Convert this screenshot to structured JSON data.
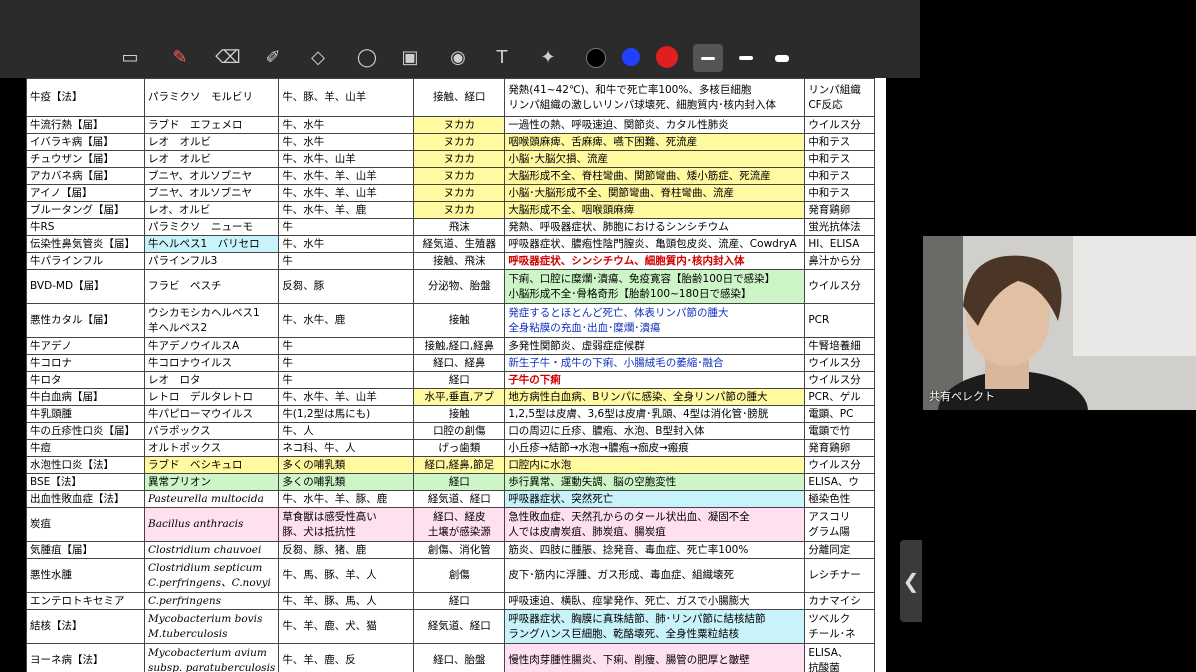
{
  "toolbar": {
    "tools": [
      {
        "name": "layers-icon",
        "glyph": "▭"
      },
      {
        "name": "pen-icon",
        "glyph": "✎"
      },
      {
        "name": "eraser-icon",
        "glyph": "⌫"
      },
      {
        "name": "highlighter-icon",
        "glyph": "✐"
      },
      {
        "name": "shapes-icon",
        "glyph": "◇"
      },
      {
        "name": "lasso-icon",
        "glyph": "◯"
      },
      {
        "name": "image-icon",
        "glyph": "▣"
      },
      {
        "name": "camera-icon",
        "glyph": "◉"
      },
      {
        "name": "text-icon",
        "glyph": "T"
      },
      {
        "name": "laser-pointer-icon",
        "glyph": "✦"
      }
    ],
    "colors": [
      "#000000",
      "#2040ff",
      "#e02020"
    ],
    "line_widths": [
      "thin",
      "medium",
      "thick"
    ]
  },
  "video": {
    "name_label": "共有ペレクト"
  },
  "nav_tab": {
    "glyph": "❮"
  },
  "table": {
    "rows": [
      {
        "h": 38,
        "c1": "牛疫【法】",
        "c2": "パラミクソ　モルビリ",
        "c3": "牛、豚、羊、山羊",
        "c4": "接触、経口",
        "c5": "発熱(41~42℃)、和牛で死亡率100%、多核巨細胞 / リンパ組織の激しいリンパ球壊死、細胞質内･核内封入体",
        "c6": "リンパ組織 / CF反応"
      },
      {
        "h": 17,
        "c1": "牛流行熱【届】",
        "c2": "ラブド　エフェメロ",
        "c3": "牛、水牛",
        "c4": "ヌカカ",
        "c4cls": "hl-y",
        "c5": "一過性の熱、呼吸速迫、関節炎、カタル性肺炎",
        "c6": "ウイルス分"
      },
      {
        "h": 17,
        "c1": "イバラキ病【届】",
        "c2": "レオ　オルビ",
        "c3": "牛、水牛",
        "c4": "ヌカカ",
        "c4cls": "hl-y",
        "c5": "咽喉頭麻痺、舌麻痺、嚥下困難、死流産",
        "c5cls": "hl-y",
        "c6": "中和テス"
      },
      {
        "h": 17,
        "c1": "チュウザン【届】",
        "c2": "レオ　オルビ",
        "c3": "牛、水牛、山羊",
        "c4": "ヌカカ",
        "c4cls": "hl-y",
        "c5": "小脳･大脳欠損、流産",
        "c5cls": "hl-y",
        "c6": "中和テス"
      },
      {
        "h": 17,
        "c1": "アカバネ病【届】",
        "c2": "ブニヤ、オルソブニヤ",
        "c3": "牛、水牛、羊、山羊",
        "c4": "ヌカカ",
        "c4cls": "hl-y",
        "c5": "大脳形成不全、脊柱彎曲、関節彎曲、矮小筋症、死流産",
        "c5cls": "hl-y",
        "c6": "中和テス"
      },
      {
        "h": 17,
        "c1": "アイノ【届】",
        "c2": "ブニヤ、オルソブニヤ",
        "c3": "牛、水牛、羊、山羊",
        "c4": "ヌカカ",
        "c4cls": "hl-y",
        "c5": "小脳･大脳形成不全、関節彎曲、脊柱彎曲、流産",
        "c5cls": "hl-y",
        "c6": "中和テス"
      },
      {
        "h": 17,
        "c1": "ブルータング【届】",
        "c2": "レオ、オルビ",
        "c3": "牛、水牛、羊、鹿",
        "c4": "ヌカカ",
        "c4cls": "hl-y",
        "c5": "大脳形成不全、咽喉頭麻痺",
        "c5cls": "hl-y",
        "c6": "発育鶏卵"
      },
      {
        "h": 17,
        "c1": "牛RS",
        "c2": "パラミクソ　ニューモ",
        "c3": "牛",
        "c4": "飛沫",
        "c5": "発熱、呼吸器症状、肺胞におけるシンシチウム",
        "c6": "蛍光抗体法"
      },
      {
        "h": 17,
        "c1": "伝染性鼻気管炎【届】",
        "c2": "牛ヘルペス1　バリセロ",
        "c2cls": "hl-c",
        "c3": "牛、水牛",
        "c4": "経気道、生殖器",
        "c5": "呼吸器症状、膿疱性陰門膣炎、亀頭包皮炎、流産、CowdryA",
        "c6": "HI、ELISA"
      },
      {
        "h": 17,
        "c1": "牛パラインフル",
        "c2": "パラインフル3",
        "c3": "牛",
        "c4": "接触、飛沫",
        "c5": "呼吸器症状、シンシチウム、細胞質内･核内封入体",
        "c5red": true,
        "c6": "鼻汁から分"
      },
      {
        "h": 34,
        "c1": "BVD-MD【届】",
        "c2": "フラビ　ペスチ",
        "c3": "反芻、豚",
        "c4": "分泌物、胎盤",
        "c5": "下痢、口腔に糜爛･潰瘍、免疫寛容【胎齢100日で感染】 / 小脳形成不全･骨格奇形【胎齢100~180日で感染】",
        "c5cls": "hl-g",
        "c6": "ウイルス分"
      },
      {
        "h": 34,
        "c1": "悪性カタル【届】",
        "c2": "ウシカモシカヘルペス1 / 羊ヘルペス2",
        "c3": "牛、水牛、鹿",
        "c4": "接触",
        "c5": "発症するとほとんど死亡、体表リンパ節の腫大 / 全身粘膜の充血･出血･糜爛･潰瘍",
        "c5blue": true,
        "c6": "PCR"
      },
      {
        "h": 17,
        "c1": "牛アデノ",
        "c2": "牛アデノウイルスA",
        "c3": "牛",
        "c4": "接触,経口,経鼻",
        "c5": "多発性関節炎、虚弱症症候群",
        "c6": "牛腎培養細"
      },
      {
        "h": 17,
        "c1": "牛コロナ",
        "c2": "牛コロナウイルス",
        "c3": "牛",
        "c4": "経口、経鼻",
        "c5": "新生子牛・成牛の下痢、小腸絨毛の萎縮･融合",
        "c5blue": true,
        "c6": "ウイルス分"
      },
      {
        "h": 17,
        "c1": "牛ロタ",
        "c2": "レオ　ロタ",
        "c3": "牛",
        "c4": "経口",
        "c5": "子牛の下痢",
        "c5red": true,
        "c6": "ウイルス分"
      },
      {
        "h": 17,
        "c1": "牛白血病【届】",
        "c2": "レトロ　デルタレトロ",
        "c3": "牛、水牛、羊、山羊",
        "c4": "水平,垂直,アブ",
        "c4cls": "hl-y",
        "c5": "地方病性白血病、Bリンパに感染、全身リンパ節の腫大",
        "c5cls": "hl-y",
        "c6": "PCR、ゲル"
      },
      {
        "h": 17,
        "c1": "牛乳頭腫",
        "c2": "牛パピローマウイルス",
        "c3": "牛(1,2型は馬にも)",
        "c4": "接触",
        "c5": "1,2,5型は皮膚、3,6型は皮膚･乳頭、4型は消化管･膀胱",
        "c6": "電顕、PC"
      },
      {
        "h": 17,
        "c1": "牛の丘疹性口炎【届】",
        "c2": "パラポックス",
        "c3": "牛、人",
        "c4": "口腔の創傷",
        "c5": "口の周辺に丘疹、膿疱、水泡、B型封入体",
        "c6": "電顕で竹"
      },
      {
        "h": 17,
        "c1": "牛痘",
        "c2": "オルトポックス",
        "c3": "ネコ科、牛、人",
        "c4": "げっ歯類",
        "c5": "小丘疹→結節→水泡→膿疱→痂皮→瘢痕",
        "c6": "発育鶏卵"
      },
      {
        "h": 17,
        "c1": "水泡性口炎【法】",
        "c2": "ラブド　ベシキュロ",
        "c2cls": "hl-y",
        "c3": "多くの哺乳類",
        "c3cls": "hl-y",
        "c4": "経口,経鼻,節足",
        "c4cls": "hl-y",
        "c5": "口腔内に水泡",
        "c5cls": "hl-y",
        "c6": "ウイルス分"
      },
      {
        "h": 17,
        "c1": "BSE【法】",
        "c2": "異常プリオン",
        "c2cls": "hl-g",
        "c3": "多くの哺乳類",
        "c3cls": "hl-g",
        "c4": "経口",
        "c4cls": "hl-g",
        "c5": "歩行異常、運動失調、脳の空胞変性",
        "c5cls": "hl-g",
        "c6": "ELISA、ウ"
      },
      {
        "h": 17,
        "c1": "出血性敗血症【法】",
        "c2": "Pasteurella multocida",
        "c2lat": true,
        "c3": "牛、水牛、羊、豚、鹿",
        "c4": "経気道、経口",
        "c5": "呼吸器症状、突然死亡",
        "c5cls": "hl-c",
        "c6": "極染色性"
      },
      {
        "h": 34,
        "c1": "炭疽",
        "c2": "Bacillus anthracis",
        "c2lat": true,
        "c2cls": "hl-p",
        "c3": "草食獣は感受性高い / 豚、犬は抵抗性",
        "c3cls": "hl-p",
        "c4": "経口、経皮 / 土壌が感染源",
        "c4cls": "hl-p",
        "c5": "急性敗血症、天然孔からのタール状出血、凝固不全 / 人では皮膚炭疽、肺炭疽、腸炭疽",
        "c5cls": "hl-p",
        "c6": "アスコリ / グラム陽"
      },
      {
        "h": 17,
        "c1": "気腫疽【届】",
        "c2": "Clostridium chauvoei",
        "c2lat": true,
        "c3": "反芻、豚、猪、鹿",
        "c4": "創傷、消化管",
        "c5": "筋炎、四肢に腫脹、捻発音、毒血症、死亡率100%",
        "c6": "分離同定"
      },
      {
        "h": 34,
        "c1": "悪性水腫",
        "c2": "Clostridium septicum / C.perfringens、C.novyi",
        "c2lat": true,
        "c3": "牛、馬、豚、羊、人",
        "c4": "創傷",
        "c5": "皮下･筋内に浮腫、ガス形成、毒血症、組織壊死",
        "c6": "レシチナー"
      },
      {
        "h": 17,
        "c1": "エンテロトキセミア",
        "c2": "C.perfringens",
        "c2lat": true,
        "c3": "牛、羊、豚、馬、人",
        "c4": "経口",
        "c5": "呼吸速迫、横臥、痙攣発作、死亡、ガスで小腸膨大",
        "c6": "カナマイシ"
      },
      {
        "h": 34,
        "c1": "結核【法】",
        "c2": "Mycobacterium bovis / M.tuberculosis",
        "c2lat": true,
        "c3": "牛、羊、鹿、犬、猫",
        "c4": "経気道、経口",
        "c5": "呼吸器症状、胸膜に真珠結節、肺･リンパ節に結核結節 / ラングハンス巨細胞、乾酪壊死、全身性粟粒結核",
        "c5cls": "hl-c",
        "c6": "ツベルク / チール･ネ"
      },
      {
        "h": 34,
        "c1": "ヨーネ病【法】",
        "c2": "Mycobacterium avium / subsp. paratuberculosis",
        "c2lat": true,
        "c3": "牛、羊、鹿、反",
        "c4": "経口、胎盤",
        "c5": "慢性肉芽腫性腸炎、下痢、削痩、腸管の肥厚と皺壁",
        "c5cls": "hl-p",
        "c6": "ELISA、 / 抗酸菌"
      }
    ]
  }
}
